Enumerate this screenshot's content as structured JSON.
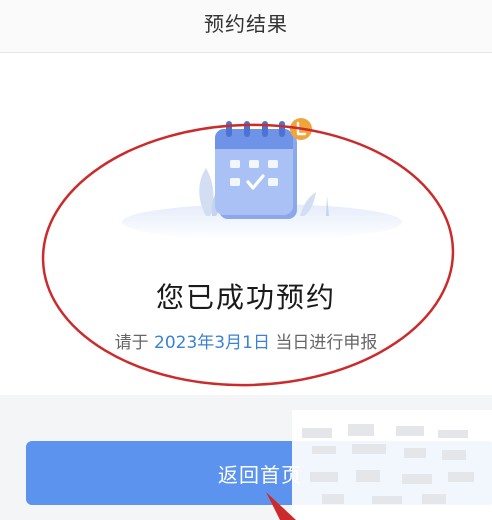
{
  "header": {
    "title": "预约结果"
  },
  "result": {
    "title": "您已成功预约",
    "desc_prefix": "请于",
    "date": "2023年3月1日",
    "desc_suffix": "当日进行申报"
  },
  "actions": {
    "home_label": "返回首页"
  },
  "colors": {
    "primary_button": "#5b93ef",
    "date_text": "#3b82d6",
    "annotation_red": "#cc2b2b",
    "badge_orange": "#f0a53a"
  },
  "icons": {
    "calendar": "calendar-check-icon",
    "badge": "notification-badge-icon"
  }
}
